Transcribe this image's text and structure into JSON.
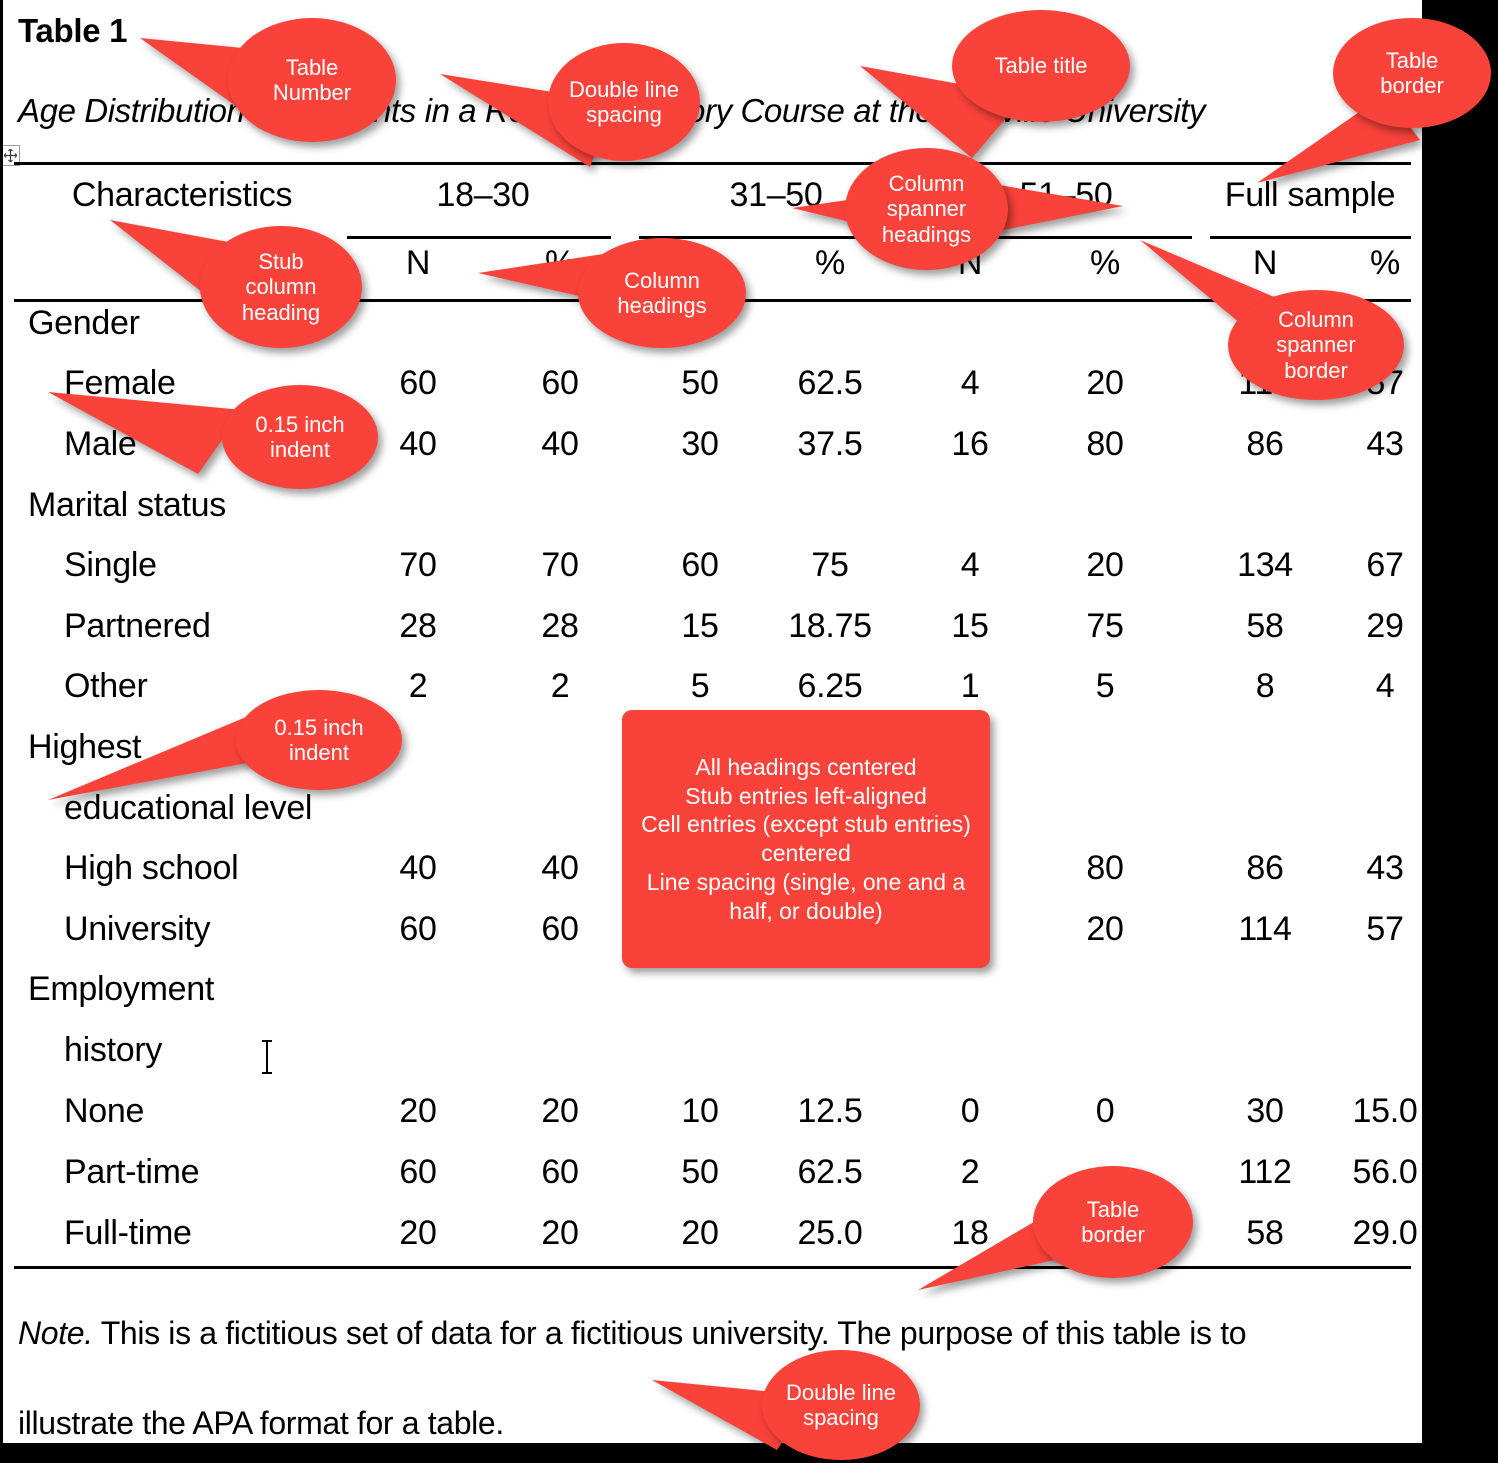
{
  "document": {
    "table_number": "Table 1",
    "table_title": "Age Distribution of Students in a Research History Course at the Ellisville University",
    "resize_handle_glyph": "☩"
  },
  "table": {
    "stub_heading": "Characteristics",
    "spanners": [
      "18–30",
      "31–50",
      "51–50",
      "Full sample"
    ],
    "column_headings": [
      "N",
      "%",
      "N",
      "%",
      "N",
      "%",
      "N",
      "%"
    ],
    "rows": [
      {
        "label": "Gender",
        "level": 0,
        "values": [
          "",
          "",
          "",
          "",
          "",
          "",
          "",
          ""
        ]
      },
      {
        "label": "Female",
        "level": 1,
        "values": [
          "60",
          "60",
          "50",
          "62.5",
          "4",
          "20",
          "114",
          "57"
        ]
      },
      {
        "label": "Male",
        "level": 1,
        "values": [
          "40",
          "40",
          "30",
          "37.5",
          "16",
          "80",
          "86",
          "43"
        ]
      },
      {
        "label": "Marital status",
        "level": 0,
        "values": [
          "",
          "",
          "",
          "",
          "",
          "",
          "",
          ""
        ]
      },
      {
        "label": "Single",
        "level": 1,
        "values": [
          "70",
          "70",
          "60",
          "75",
          "4",
          "20",
          "134",
          "67"
        ]
      },
      {
        "label": "Partnered",
        "level": 1,
        "values": [
          "28",
          "28",
          "15",
          "18.75",
          "15",
          "75",
          "58",
          "29"
        ]
      },
      {
        "label": "Other",
        "level": 1,
        "values": [
          "2",
          "2",
          "5",
          "6.25",
          "1",
          "5",
          "8",
          "4"
        ]
      },
      {
        "label": "Highest",
        "level": 0,
        "values": [
          "",
          "",
          "",
          "",
          "",
          "",
          "",
          ""
        ]
      },
      {
        "label": "educational level",
        "level": 1,
        "values": [
          "",
          "",
          "",
          "",
          "",
          "",
          "",
          ""
        ]
      },
      {
        "label": "High school",
        "level": 1,
        "values": [
          "40",
          "40",
          "",
          "",
          "",
          "80",
          "86",
          "43"
        ]
      },
      {
        "label": "University",
        "level": 1,
        "values": [
          "60",
          "60",
          "",
          "",
          "",
          "20",
          "114",
          "57"
        ]
      },
      {
        "label": "Employment",
        "level": 0,
        "values": [
          "",
          "",
          "",
          "",
          "",
          "",
          "",
          ""
        ]
      },
      {
        "label": "history",
        "level": 1,
        "values": [
          "",
          "",
          "",
          "",
          "",
          "",
          "",
          ""
        ]
      },
      {
        "label": "None",
        "level": 1,
        "values": [
          "20",
          "20",
          "10",
          "12.5",
          "0",
          "0",
          "30",
          "15.0"
        ]
      },
      {
        "label": "Part-time",
        "level": 1,
        "values": [
          "60",
          "60",
          "50",
          "62.5",
          "2",
          "",
          "112",
          "56.0"
        ]
      },
      {
        "label": "Full-time",
        "level": 1,
        "values": [
          "20",
          "20",
          "20",
          "25.0",
          "18",
          "",
          "58",
          "29.0"
        ]
      }
    ],
    "note_line1_label": "Note.",
    "note_line1": " This is a fictitious set of data for a fictitious university. The purpose of this table is to",
    "note_line2": "illustrate the APA format for a table."
  },
  "annotations": {
    "accent_color": "#f9423a",
    "text_color": "#ffffff",
    "items": [
      {
        "id": "table-number",
        "text": "Table\nNumber"
      },
      {
        "id": "double-line-spacing-1",
        "text": "Double line\nspacing"
      },
      {
        "id": "table-title",
        "text": "Table title"
      },
      {
        "id": "table-border-top",
        "text": "Table\nborder"
      },
      {
        "id": "column-spanner-headings",
        "text": "Column\nspanner\nheadings"
      },
      {
        "id": "stub-column-heading",
        "text": "Stub\ncolumn\nheading"
      },
      {
        "id": "column-headings",
        "text": "Column\nheadings"
      },
      {
        "id": "column-spanner-border",
        "text": "Column\nspanner\nborder"
      },
      {
        "id": "indent-1",
        "text": "0.15 inch\nindent"
      },
      {
        "id": "indent-2",
        "text": "0.15 inch\nindent"
      },
      {
        "id": "alignment-rules",
        "text": "All headings centered\nStub entries left-aligned\nCell entries (except stub entries) centered\nLine spacing (single, one and a half, or double)"
      },
      {
        "id": "table-border-bottom",
        "text": "Table\nborder"
      },
      {
        "id": "double-line-spacing-2",
        "text": "Double line\nspacing"
      }
    ]
  }
}
